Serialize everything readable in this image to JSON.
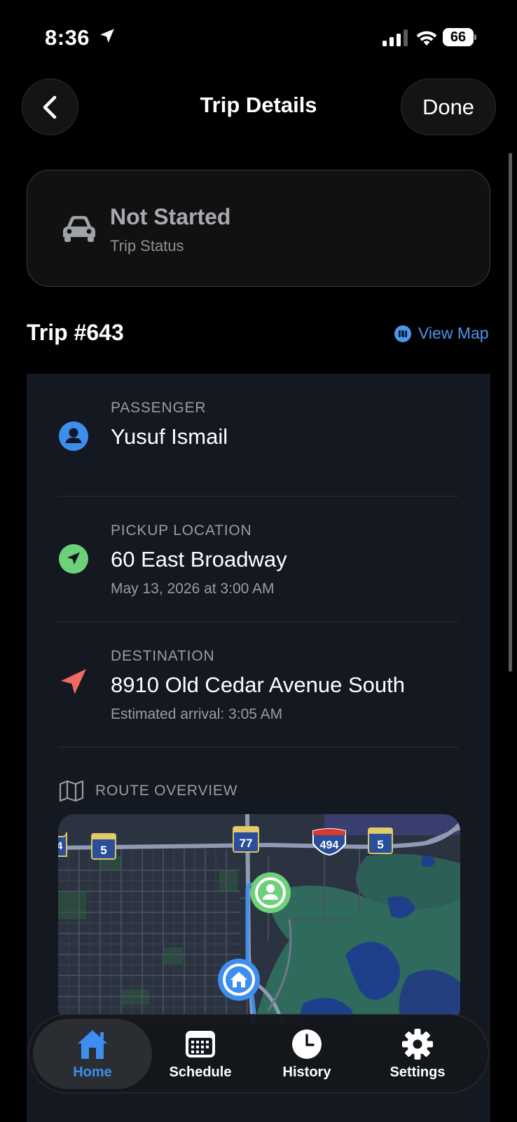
{
  "status_bar": {
    "time": "8:36",
    "battery": "66"
  },
  "nav": {
    "title": "Trip Details",
    "done_label": "Done"
  },
  "trip_status": {
    "value": "Not Started",
    "label": "Trip Status"
  },
  "trip": {
    "number": "Trip #643",
    "view_map_label": "View Map"
  },
  "passenger": {
    "label": "PASSENGER",
    "name": "Yusuf Ismail"
  },
  "pickup": {
    "label": "PICKUP LOCATION",
    "address": "60 East Broadway",
    "time": "May 13, 2026 at 3:00 AM"
  },
  "destination": {
    "label": "DESTINATION",
    "address": "8910 Old Cedar Avenue South",
    "eta": "Estimated arrival: 3:05 AM"
  },
  "route": {
    "label": "ROUTE OVERVIEW",
    "shields": {
      "i494": "494",
      "hwy77": "77",
      "hwy5_left": "5",
      "hwy5_right": "5",
      "cut_left": "4"
    }
  },
  "tabs": [
    {
      "label": "Home",
      "active": true
    },
    {
      "label": "Schedule",
      "active": false
    },
    {
      "label": "History",
      "active": false
    },
    {
      "label": "Settings",
      "active": false
    }
  ],
  "colors": {
    "accent_blue": "#3d8ef0",
    "pickup_green": "#6dd07a",
    "destination_red": "#f06a62",
    "background": "#000000",
    "panel": "#141820"
  }
}
